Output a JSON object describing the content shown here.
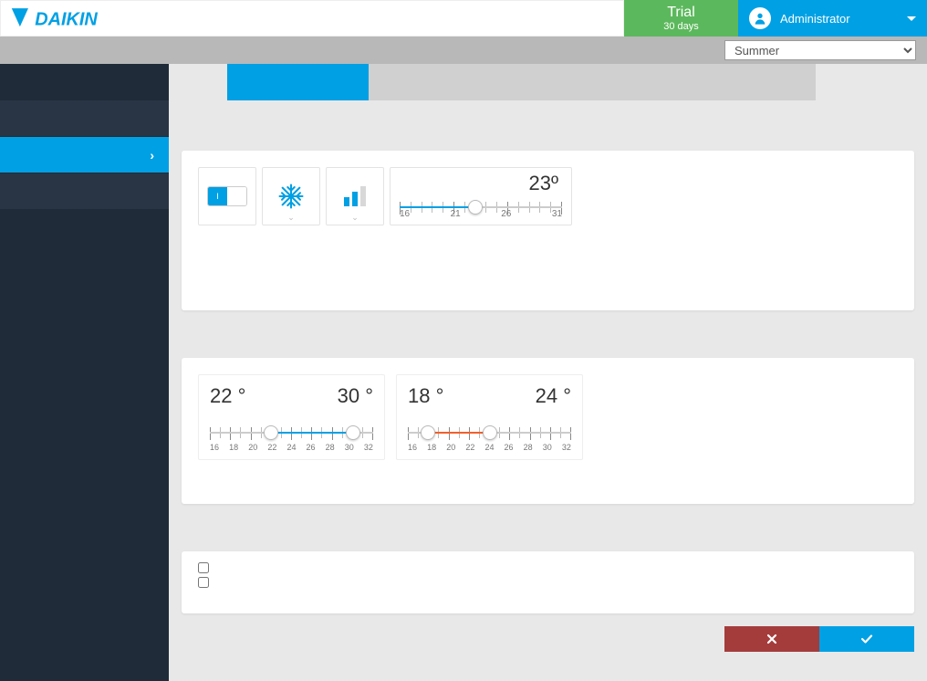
{
  "header": {
    "trial_title": "Trial",
    "trial_days": "30 days",
    "username": "Administrator"
  },
  "season_select": {
    "value": "Summer"
  },
  "setpoint": {
    "value_display": "23º",
    "ticks": [
      "16",
      "21",
      "26",
      "31"
    ],
    "min": 16,
    "max": 31,
    "value": 23
  },
  "range_cool": {
    "low_display": "22 °",
    "high_display": "30 °",
    "ticks": [
      "16",
      "18",
      "20",
      "22",
      "24",
      "26",
      "28",
      "30",
      "32"
    ],
    "min": 16,
    "max": 32,
    "low": 22,
    "high": 30,
    "fill_color": "#00A0E4"
  },
  "range_heat": {
    "low_display": "18 °",
    "high_display": "24 °",
    "ticks": [
      "16",
      "18",
      "20",
      "22",
      "24",
      "26",
      "28",
      "30",
      "32"
    ],
    "min": 16,
    "max": 32,
    "low": 18,
    "high": 24,
    "fill_color": "#f0602c"
  },
  "toggle": {
    "on_label": "I"
  },
  "checkboxes": {
    "opt1": false,
    "opt2": false
  }
}
